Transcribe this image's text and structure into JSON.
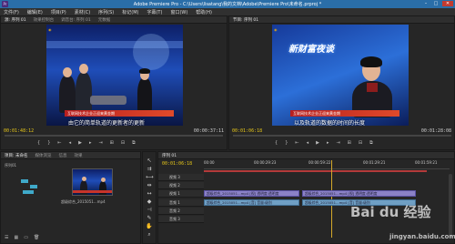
{
  "window": {
    "app_title": "Adobe Premiere Pro - C:\\Users\\lisatang\\我的文档\\Adobe\\Premiere Pro\\未命名.prproj *",
    "minimize": "–",
    "maximize": "□",
    "close": "✕"
  },
  "menu": [
    "文件(F)",
    "编辑(E)",
    "项目(P)",
    "素材(C)",
    "序列(S)",
    "标记(M)",
    "字幕(T)",
    "窗口(W)",
    "帮助(H)"
  ],
  "source_monitor": {
    "tabs": [
      "源: 序列 01",
      "效果控制台",
      "调音台: 序列 01",
      "元数据"
    ],
    "timecode_current": "00:01:48:12",
    "timecode_duration": "00:00:37:11",
    "lower_third": "互联网技术企业正迎来黄金期",
    "subtitle": "由它的简单轨道的更新者的更新"
  },
  "program_monitor": {
    "tabs": [
      "节目: 序列 01"
    ],
    "timecode_current": "00:01:06:18",
    "timecode_duration": "00:01:28:08",
    "show_title": "新财富夜谈",
    "lower_third": "互联网技术企业正迎来黄金期",
    "subtitle": "以及轨道的数据的时间的长度"
  },
  "project_panel": {
    "tabs": [
      "项目: 未命名",
      "媒体浏览",
      "信息",
      "效果"
    ],
    "bin_label": "序列01",
    "clip_name": "超级综合_2015051...mp4"
  },
  "timeline": {
    "tab": "序列 01",
    "timecode": "00:01:06:18",
    "ruler_labels": [
      "00:00",
      "00:00:29:23",
      "00:00:59:22",
      "00:01:29:21",
      "00:01:59:21"
    ],
    "tracks": [
      {
        "name": "视频 3",
        "kind": "video"
      },
      {
        "name": "视频 2",
        "kind": "video"
      },
      {
        "name": "视频 1",
        "kind": "video"
      },
      {
        "name": "音频 1",
        "kind": "audio"
      },
      {
        "name": "音频 2",
        "kind": "audio"
      },
      {
        "name": "音频 3",
        "kind": "audio"
      }
    ],
    "clip_v1_a": "超级综合_2015051...mp4 [视] 透明度:透明度",
    "clip_v1_b": "超级综合_2015051...mp4 [视] 透明度:透明度",
    "clip_a1_a": "超级综合_2015051...mp4 [音] 音量:级别",
    "clip_a1_b": "超级综合_2015051...mp4 [音] 音量:级别"
  },
  "watermark": {
    "brand": "Bai du 经验",
    "url": "jingyan.baidu.com"
  },
  "colors": {
    "timecode": "#e6c619",
    "video_clip": "#8b82c6",
    "audio_clip": "#6f9fc4",
    "title_bar": "#2a6ea8"
  }
}
